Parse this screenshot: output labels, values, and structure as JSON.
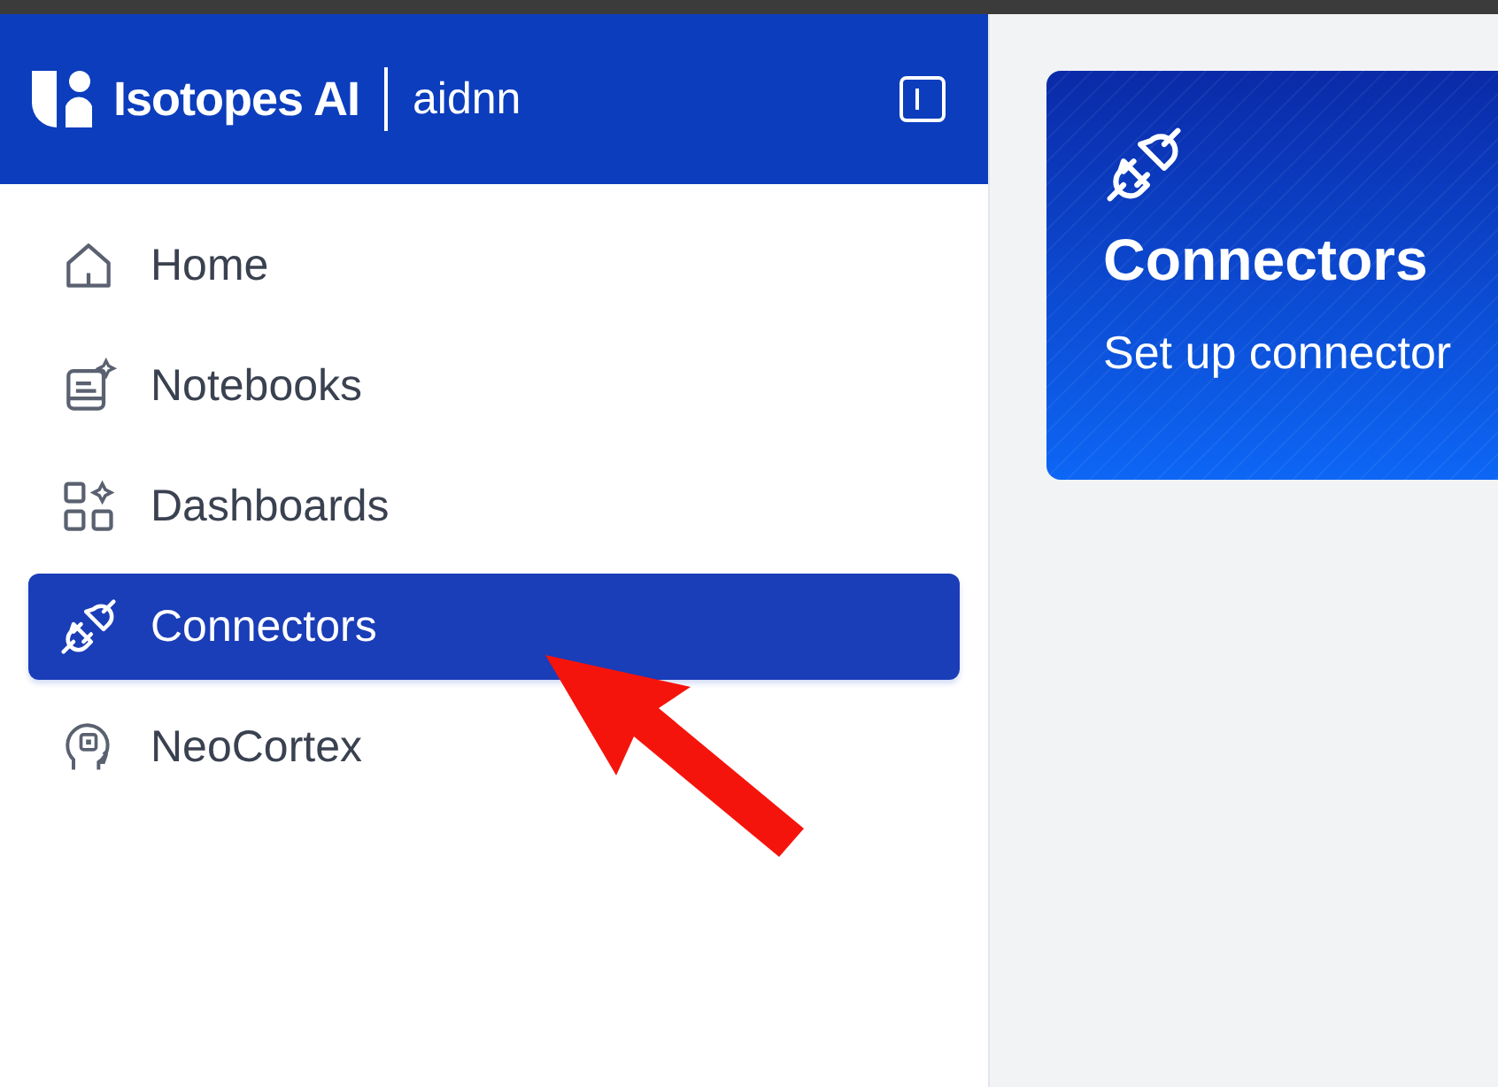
{
  "sidebar": {
    "brand": "Isotopes AI",
    "product": "aidnn",
    "items": [
      {
        "label": "Home",
        "selected": false
      },
      {
        "label": "Notebooks",
        "selected": false
      },
      {
        "label": "Dashboards",
        "selected": false
      },
      {
        "label": "Connectors",
        "selected": true
      },
      {
        "label": "NeoCortex",
        "selected": false
      }
    ]
  },
  "main": {
    "card": {
      "title": "Connectors",
      "description": "Set up connector"
    }
  }
}
